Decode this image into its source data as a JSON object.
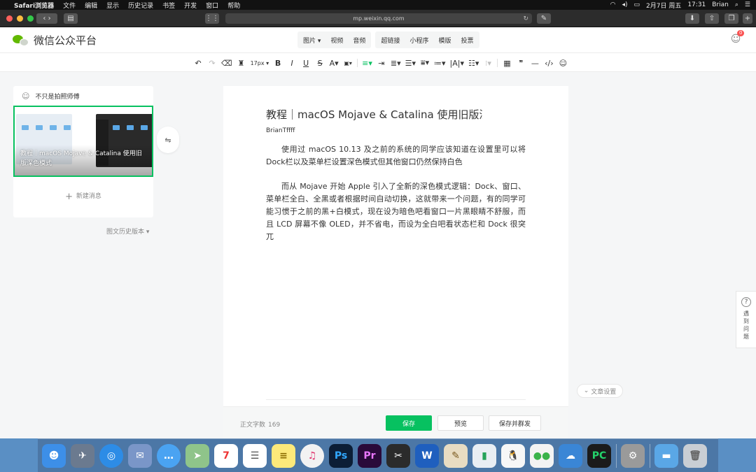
{
  "menubar": {
    "app": "Safari浏览器",
    "items": [
      "文件",
      "编辑",
      "显示",
      "历史记录",
      "书签",
      "开发",
      "窗口",
      "帮助"
    ],
    "status": [
      "2月7日 周五",
      "17:31",
      "Brian"
    ]
  },
  "safari": {
    "url": "mp.weixin.qq.com"
  },
  "header": {
    "brand": "微信公众平台",
    "tab_group_1": [
      "图片",
      "视频",
      "音频"
    ],
    "tab_group_2": [
      "超链接",
      "小程序",
      "模版",
      "投票"
    ],
    "badge": "0"
  },
  "toolbar": {
    "font_size": "17px"
  },
  "left": {
    "account": "不只是拍照师傅",
    "card_title": "教程｜macOS Mojave & Catalina 使用旧版深色模式",
    "new_message": "新建消息",
    "history": "图文历史版本"
  },
  "editor": {
    "title": "教程｜macOS Mojave & Catalina 使用旧版深色",
    "author": "BrianTffff",
    "paragraph1": "使用过 macOS 10.13 及之前的系统的同学应该知道在设置里可以将Dock栏以及菜单栏设置深色模式但其他窗口仍然保持白色",
    "paragraph2": "而从 Mojave 开始 Apple 引入了全新的深色模式逻辑：Dock、窗口、菜单栏全白、全黑或者根据时间自动切换，这就带来一个问题，有的同学可能习惯于之前的黑+白模式，现在设为暗色吧看窗口一片黑眼睛不舒服，而且 LCD 屏幕不像 OLED，并不省电，而设为全白吧看状态栏和 Dock 很突兀"
  },
  "bottom": {
    "word_count_label": "正文字数",
    "word_count": "169",
    "save": "保存",
    "preview": "预览",
    "save_publish": "保存并群发"
  },
  "side": {
    "settings": "文章设置",
    "help": [
      "遇",
      "到",
      "问",
      "题"
    ]
  },
  "colors": {
    "accent": "#07c160",
    "badge": "#fa5151"
  }
}
